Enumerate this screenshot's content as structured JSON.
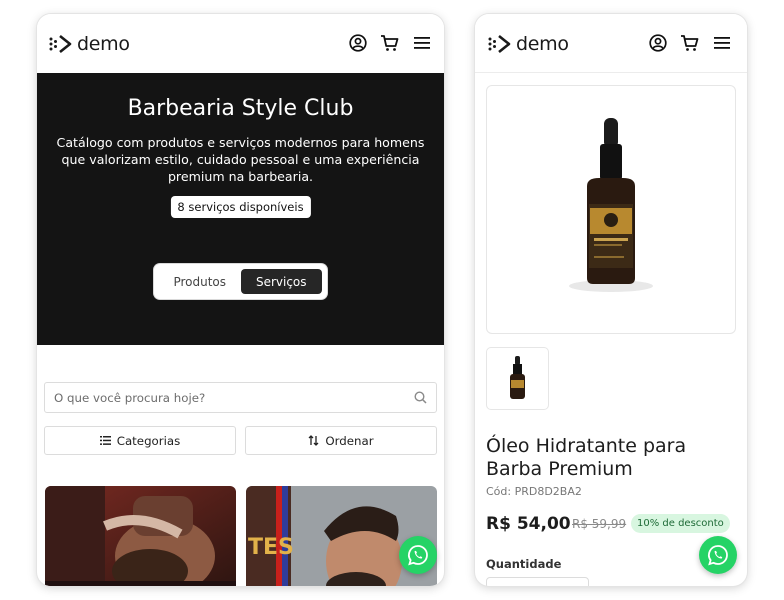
{
  "brand": {
    "logo_text": "demo"
  },
  "catalog_screen": {
    "hero": {
      "title": "Barbearia Style Club",
      "description": "Catálogo com produtos e serviços modernos para homens que valorizam estilo, cuidado pessoal e uma experiência premium na barbearia.",
      "badge": "8 serviços disponíveis",
      "toggle": {
        "products_label": "Produtos",
        "services_label": "Serviços",
        "active": "Serviços"
      }
    },
    "search": {
      "placeholder": "O que você procura hoje?"
    },
    "filters": {
      "categories_label": "Categorias",
      "sort_label": "Ordenar"
    },
    "cards": [
      {
        "image": "barber-shaving-photo"
      },
      {
        "image": "fade-haircut-photo"
      }
    ]
  },
  "product_screen": {
    "product": {
      "name": "Óleo Hidratante para Barba Premium",
      "code": "Cód: PRD8D2BA2",
      "price": "R$ 54,00",
      "old_price": "R$ 59,99",
      "discount": "10% de desconto",
      "quantity_label": "Quantidade"
    }
  },
  "icons": [
    "logo-arrow-icon",
    "user-icon",
    "cart-icon",
    "menu-icon",
    "search-icon",
    "list-icon",
    "sort-icon",
    "whatsapp-icon"
  ],
  "colors": {
    "hero_bg": "#141414",
    "toggle_active": "#262626",
    "whatsapp": "#25d366",
    "discount_bg": "#d8f6e0",
    "discount_text": "#1e6b37"
  }
}
